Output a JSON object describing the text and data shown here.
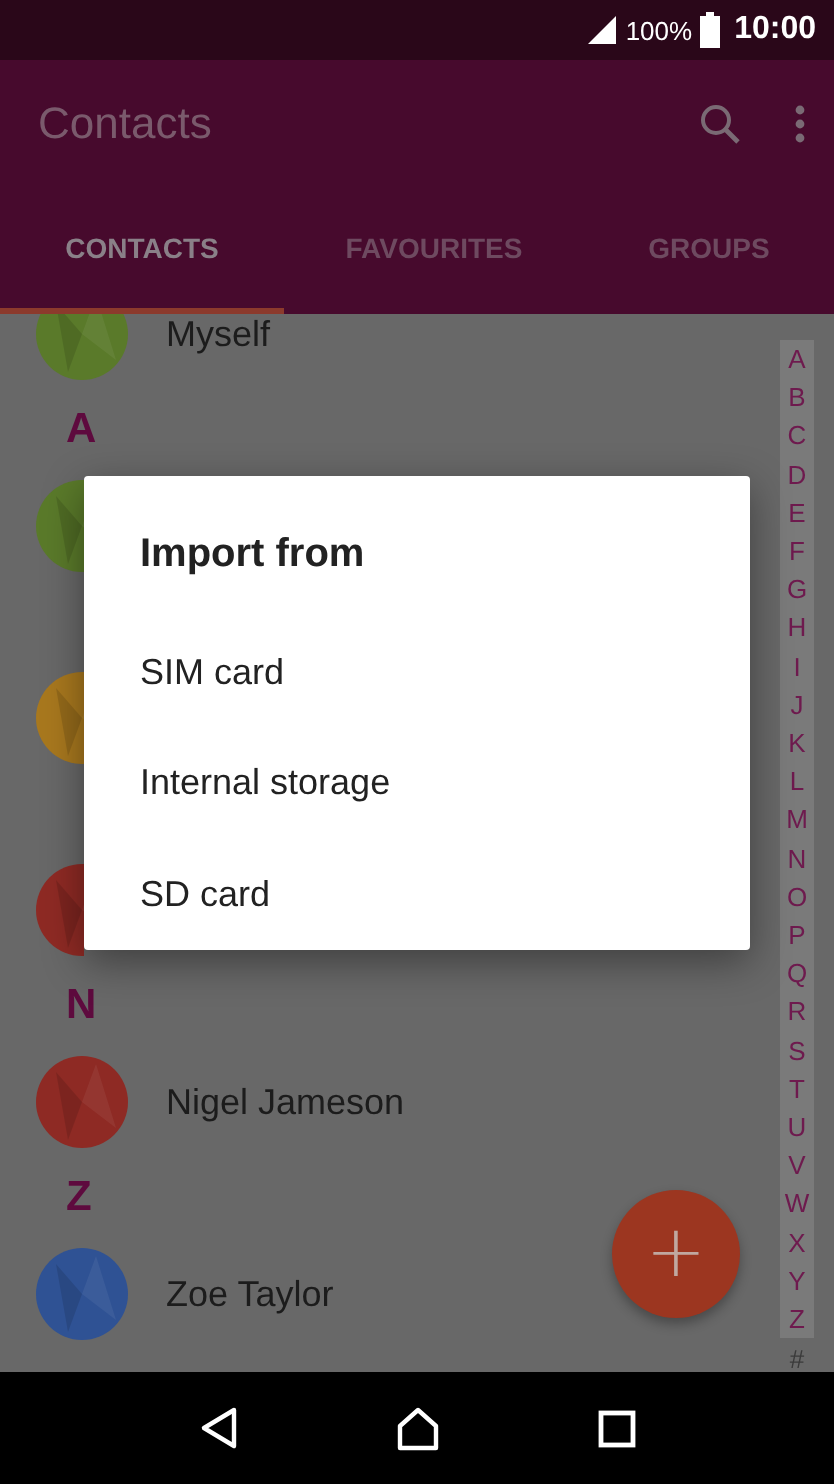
{
  "status_bar": {
    "battery": "100%",
    "time": "10:00"
  },
  "app_bar": {
    "title": "Contacts"
  },
  "tabs": [
    {
      "label": "CONTACTS",
      "selected": true
    },
    {
      "label": "FAVOURITES",
      "selected": false
    },
    {
      "label": "GROUPS",
      "selected": false
    }
  ],
  "list": [
    {
      "kind": "contact",
      "name": "Myself",
      "color": "#5a7a2a"
    },
    {
      "kind": "header",
      "label": "A"
    },
    {
      "kind": "contact",
      "color": "#5a7a2a"
    },
    {
      "kind": "header"
    },
    {
      "kind": "contact",
      "color": "#a8781e"
    },
    {
      "kind": "header"
    },
    {
      "kind": "contact",
      "color": "#8e2a24"
    },
    {
      "kind": "header",
      "label": "N"
    },
    {
      "kind": "contact",
      "name": "Nigel Jameson",
      "color": "#8e2a24"
    },
    {
      "kind": "header",
      "label": "Z"
    },
    {
      "kind": "contact",
      "name": "Zoe Taylor",
      "color": "#2f5294"
    }
  ],
  "index": [
    "A",
    "B",
    "C",
    "D",
    "E",
    "F",
    "G",
    "H",
    "I",
    "J",
    "K",
    "L",
    "M",
    "N",
    "O",
    "P",
    "Q",
    "R",
    "S",
    "T",
    "U",
    "V",
    "W",
    "X",
    "Y",
    "Z"
  ],
  "index_extra": "#",
  "fab": {
    "label": "+"
  },
  "dialog": {
    "title": "Import from",
    "options": [
      "SIM card",
      "Internal storage",
      "SD card"
    ]
  }
}
